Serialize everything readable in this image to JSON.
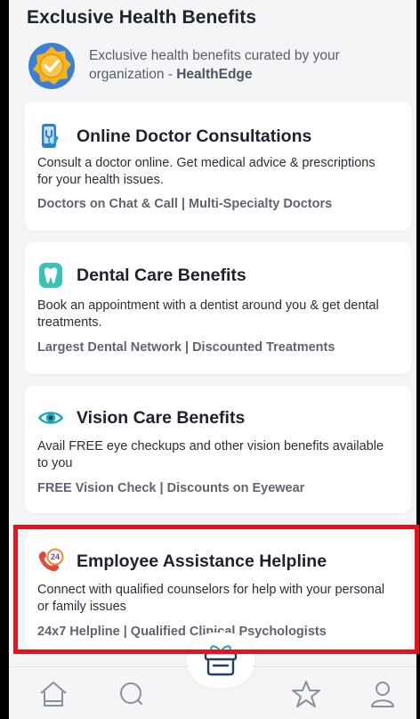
{
  "section": {
    "title": "Exclusive Health Benefits",
    "org_text_prefix": "Exclusive health benefits curated by your organization - ",
    "org_name": "HealthEdge"
  },
  "cards": [
    {
      "title": "Online Doctor Consultations",
      "desc": "Consult a doctor online. Get medical advice & prescriptions for your health issues.",
      "tags": "Doctors on Chat & Call | Multi-Specialty Doctors",
      "icon": "phone-stethoscope-icon"
    },
    {
      "title": "Dental Care Benefits",
      "desc": "Book an appointment with a dentist around you & get dental treatments.",
      "tags": "Largest Dental Network | Discounted Treatments",
      "icon": "tooth-icon"
    },
    {
      "title": "Vision Care Benefits",
      "desc": "Avail FREE eye checkups and other vision benefits available to you",
      "tags": "FREE Vision Check | Discounts on Eyewear",
      "icon": "eye-icon"
    },
    {
      "title": "Employee Assistance Helpline",
      "desc": "Connect with qualified counselors for help with your personal or family issues",
      "tags": "24x7 Helpline | Qualified Clinical Psychologists",
      "icon": "24-hour-phone-icon",
      "badge": "24"
    }
  ],
  "tabbar": {
    "items": [
      "home-icon",
      "search-icon",
      "gift-icon",
      "star-icon",
      "profile-icon"
    ],
    "active": "gift-icon"
  },
  "colors": {
    "highlight": "#e8121c",
    "accent_teal": "#1aa6b7",
    "accent_blue": "#2f7fd8"
  }
}
